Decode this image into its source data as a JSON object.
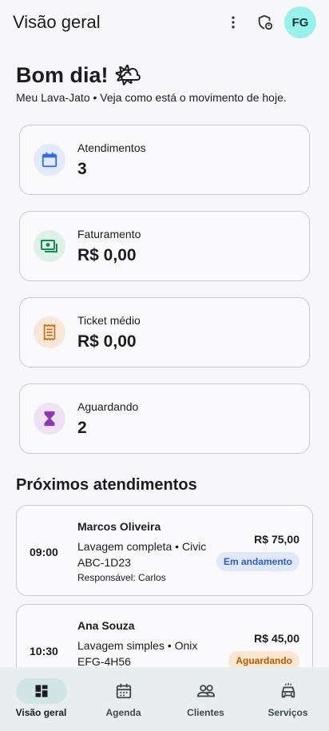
{
  "app_bar": {
    "title": "Visão geral",
    "avatar_initials": "FG",
    "icons": [
      "more-vert-icon",
      "admin-shield-icon"
    ]
  },
  "header": {
    "greeting": "Bom dia! 🌤",
    "subtitle": "Meu Lava-Jato • Veja como está o movimento de hoje."
  },
  "stats": [
    {
      "label": "Atendimentos",
      "value": "3",
      "icon": "calendar-icon",
      "color": "#2f6ee0",
      "bg": "#e3eafb"
    },
    {
      "label": "Faturamento",
      "value": "R$ 0,00",
      "icon": "cash-icon",
      "color": "#1b8a5a",
      "bg": "#dff1e7"
    },
    {
      "label": "Ticket médio",
      "value": "R$ 0,00",
      "icon": "receipt-icon",
      "color": "#c96a12",
      "bg": "#f7e8da"
    },
    {
      "label": "Aguardando",
      "value": "2",
      "icon": "hourglass-icon",
      "color": "#8a3ab0",
      "bg": "#efe2f4"
    }
  ],
  "section_title": "Próximos atendimentos",
  "appointments": [
    {
      "time": "09:00",
      "client": "Marcos Oliveira",
      "service": "Lavagem completa • Civic ABC-1D23",
      "responsible": "Responsável: Carlos",
      "price": "R$ 75,00",
      "status": "Em andamento",
      "status_color": "#2f5fc4",
      "status_bg": "#e0e8fa"
    },
    {
      "time": "10:30",
      "client": "Ana Souza",
      "service": "Lavagem simples • Onix EFG-4H56",
      "responsible": "",
      "price": "R$ 45,00",
      "status": "Aguardando",
      "status_color": "#b25c00",
      "status_bg": "#fbe6d2"
    }
  ],
  "bottom_nav": [
    {
      "label": "Visão geral",
      "icon": "dashboard-icon",
      "active": true
    },
    {
      "label": "Agenda",
      "icon": "calendar-icon",
      "active": false
    },
    {
      "label": "Clientes",
      "icon": "people-icon",
      "active": false
    },
    {
      "label": "Serviços",
      "icon": "car-icon",
      "active": false
    }
  ]
}
